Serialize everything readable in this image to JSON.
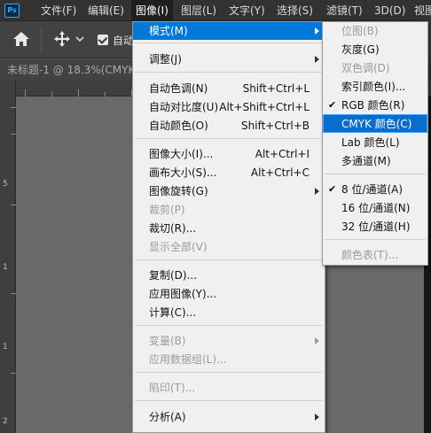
{
  "app": {
    "logo_text": "Ps"
  },
  "menubar": {
    "items": [
      {
        "label": "文件(F)"
      },
      {
        "label": "编辑(E)"
      },
      {
        "label": "图像(I)"
      },
      {
        "label": "图层(L)"
      },
      {
        "label": "文字(Y)"
      },
      {
        "label": "选择(S)"
      },
      {
        "label": "滤镜(T)"
      },
      {
        "label": "3D(D)"
      },
      {
        "label": "视图"
      }
    ]
  },
  "options_bar": {
    "auto_select_label": "自动",
    "auto_select_checked": true
  },
  "document": {
    "tab_title": "未标题-1 @ 18.3%(CMYK"
  },
  "rulers": {
    "left_labels": [
      "5",
      "1",
      "1",
      "2"
    ]
  },
  "image_menu": {
    "items": [
      {
        "label": "模式(M)",
        "has_submenu": true,
        "highlighted": true
      },
      {
        "label": "调整(J)",
        "has_submenu": true
      },
      {
        "label": "自动色调(N)",
        "shortcut": "Shift+Ctrl+L"
      },
      {
        "label": "自动对比度(U)",
        "shortcut": "Alt+Shift+Ctrl+L"
      },
      {
        "label": "自动颜色(O)",
        "shortcut": "Shift+Ctrl+B"
      },
      {
        "label": "图像大小(I)...",
        "shortcut": "Alt+Ctrl+I"
      },
      {
        "label": "画布大小(S)...",
        "shortcut": "Alt+Ctrl+C"
      },
      {
        "label": "图像旋转(G)",
        "has_submenu": true
      },
      {
        "label": "裁剪(P)",
        "disabled": true
      },
      {
        "label": "裁切(R)..."
      },
      {
        "label": "显示全部(V)",
        "disabled": true
      },
      {
        "label": "复制(D)..."
      },
      {
        "label": "应用图像(Y)..."
      },
      {
        "label": "计算(C)..."
      },
      {
        "label": "变量(B)",
        "disabled": true,
        "has_submenu": true
      },
      {
        "label": "应用数据组(L)...",
        "disabled": true
      },
      {
        "label": "陷印(T)...",
        "disabled": true
      },
      {
        "label": "分析(A)",
        "has_submenu": true
      }
    ]
  },
  "mode_submenu": {
    "items": [
      {
        "label": "位图(B)",
        "disabled": true
      },
      {
        "label": "灰度(G)"
      },
      {
        "label": "双色调(D)",
        "disabled": true
      },
      {
        "label": "索引颜色(I)..."
      },
      {
        "label": "RGB 颜色(R)",
        "checked": true
      },
      {
        "label": "CMYK 颜色(C)",
        "highlighted": true
      },
      {
        "label": "Lab 颜色(L)"
      },
      {
        "label": "多通道(M)"
      },
      {
        "label": "8 位/通道(A)",
        "checked": true
      },
      {
        "label": "16 位/通道(N)"
      },
      {
        "label": "32 位/通道(H)"
      },
      {
        "label": "颜色表(T)...",
        "disabled": true
      }
    ],
    "check_glyph": "✔"
  }
}
